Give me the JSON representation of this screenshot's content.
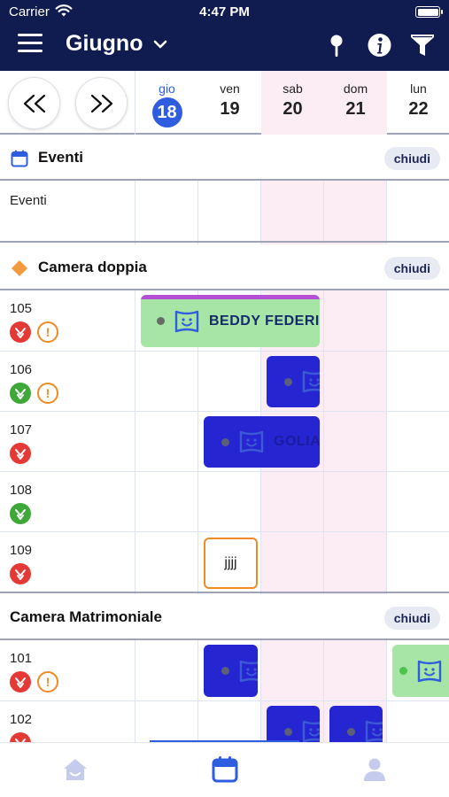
{
  "status_bar": {
    "carrier": "Carrier",
    "time": "4:47 PM"
  },
  "header": {
    "month": "Giugno",
    "icons": [
      "menu-icon",
      "chevron-down-icon",
      "pin-icon",
      "info-icon",
      "filter-icon"
    ]
  },
  "date_nav": {
    "prev_label": "<<",
    "next_label": ">>",
    "days": [
      {
        "dow": "gio",
        "num": "18",
        "today": true,
        "weekend": false
      },
      {
        "dow": "ven",
        "num": "19",
        "today": false,
        "weekend": false
      },
      {
        "dow": "sab",
        "num": "20",
        "today": false,
        "weekend": true
      },
      {
        "dow": "dom",
        "num": "21",
        "today": false,
        "weekend": true
      },
      {
        "dow": "lun",
        "num": "22",
        "today": false,
        "weekend": false
      }
    ]
  },
  "sections": {
    "eventi": {
      "title": "Eventi",
      "close_label": "chiudi",
      "row_label": "Eventi"
    },
    "camera_doppia": {
      "title": "Camera doppia",
      "close_label": "chiudi",
      "rooms": [
        {
          "number": "105",
          "status": "red",
          "warning": true
        },
        {
          "number": "106",
          "status": "green",
          "warning": true
        },
        {
          "number": "107",
          "status": "red",
          "warning": false
        },
        {
          "number": "108",
          "status": "green",
          "warning": false
        },
        {
          "number": "109",
          "status": "red",
          "warning": false
        }
      ]
    },
    "camera_matrimoniale": {
      "title": "Camera Matrimoniale",
      "close_label": "chiudi",
      "rooms": [
        {
          "number": "101",
          "status": "red",
          "warning": true
        },
        {
          "number": "102",
          "status": "red",
          "warning": false
        }
      ]
    }
  },
  "bookings": {
    "b105": {
      "name": "BEDDY FEDERIC",
      "color": "#a6e5a6"
    },
    "b107": {
      "name": "GOLIA",
      "color": "#2525d2"
    },
    "b109": {
      "name": "jjjj",
      "border": "#f08a24"
    }
  },
  "warning_symbol": "!",
  "tabs": [
    "home-icon",
    "calendar-icon",
    "user-icon"
  ],
  "colors": {
    "navy": "#101c4f",
    "accent": "#2f5de0",
    "weekend": "#fcedf4",
    "booking_blue": "#2525d2",
    "booking_green": "#a6e5a6",
    "warning": "#f08a24"
  }
}
